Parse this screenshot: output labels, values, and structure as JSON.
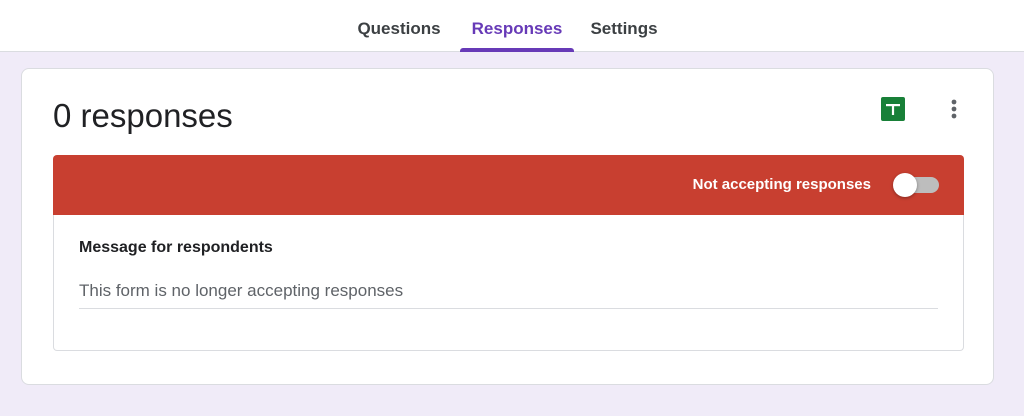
{
  "tabs": [
    {
      "label": "Questions",
      "active": false
    },
    {
      "label": "Responses",
      "active": true
    },
    {
      "label": "Settings",
      "active": false
    }
  ],
  "responses": {
    "title": "0 responses",
    "sheets_icon": "google-sheets-icon",
    "more_icon": "more-vert-icon"
  },
  "banner": {
    "text": "Not accepting responses",
    "color": "#c83f30",
    "toggle_on": false
  },
  "message": {
    "label": "Message for respondents",
    "value": "This form is no longer accepting responses"
  },
  "colors": {
    "accent": "#673ab7",
    "background": "#f0ebf8",
    "sheets_green": "#188038"
  }
}
